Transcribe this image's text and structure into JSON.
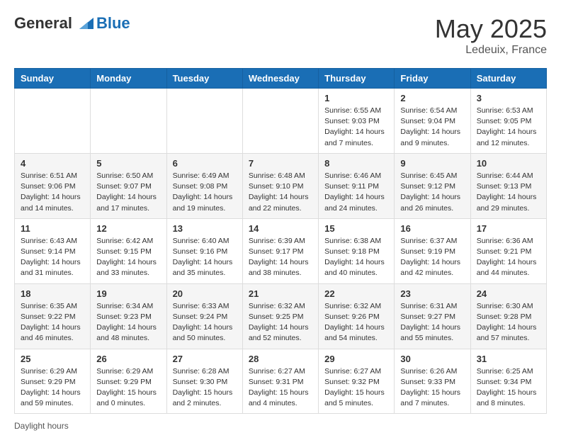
{
  "header": {
    "logo_general": "General",
    "logo_blue": "Blue",
    "month_year": "May 2025",
    "location": "Ledeuix, France"
  },
  "days_of_week": [
    "Sunday",
    "Monday",
    "Tuesday",
    "Wednesday",
    "Thursday",
    "Friday",
    "Saturday"
  ],
  "weeks": [
    [
      {
        "num": "",
        "info": ""
      },
      {
        "num": "",
        "info": ""
      },
      {
        "num": "",
        "info": ""
      },
      {
        "num": "",
        "info": ""
      },
      {
        "num": "1",
        "info": "Sunrise: 6:55 AM\nSunset: 9:03 PM\nDaylight: 14 hours\nand 7 minutes."
      },
      {
        "num": "2",
        "info": "Sunrise: 6:54 AM\nSunset: 9:04 PM\nDaylight: 14 hours\nand 9 minutes."
      },
      {
        "num": "3",
        "info": "Sunrise: 6:53 AM\nSunset: 9:05 PM\nDaylight: 14 hours\nand 12 minutes."
      }
    ],
    [
      {
        "num": "4",
        "info": "Sunrise: 6:51 AM\nSunset: 9:06 PM\nDaylight: 14 hours\nand 14 minutes."
      },
      {
        "num": "5",
        "info": "Sunrise: 6:50 AM\nSunset: 9:07 PM\nDaylight: 14 hours\nand 17 minutes."
      },
      {
        "num": "6",
        "info": "Sunrise: 6:49 AM\nSunset: 9:08 PM\nDaylight: 14 hours\nand 19 minutes."
      },
      {
        "num": "7",
        "info": "Sunrise: 6:48 AM\nSunset: 9:10 PM\nDaylight: 14 hours\nand 22 minutes."
      },
      {
        "num": "8",
        "info": "Sunrise: 6:46 AM\nSunset: 9:11 PM\nDaylight: 14 hours\nand 24 minutes."
      },
      {
        "num": "9",
        "info": "Sunrise: 6:45 AM\nSunset: 9:12 PM\nDaylight: 14 hours\nand 26 minutes."
      },
      {
        "num": "10",
        "info": "Sunrise: 6:44 AM\nSunset: 9:13 PM\nDaylight: 14 hours\nand 29 minutes."
      }
    ],
    [
      {
        "num": "11",
        "info": "Sunrise: 6:43 AM\nSunset: 9:14 PM\nDaylight: 14 hours\nand 31 minutes."
      },
      {
        "num": "12",
        "info": "Sunrise: 6:42 AM\nSunset: 9:15 PM\nDaylight: 14 hours\nand 33 minutes."
      },
      {
        "num": "13",
        "info": "Sunrise: 6:40 AM\nSunset: 9:16 PM\nDaylight: 14 hours\nand 35 minutes."
      },
      {
        "num": "14",
        "info": "Sunrise: 6:39 AM\nSunset: 9:17 PM\nDaylight: 14 hours\nand 38 minutes."
      },
      {
        "num": "15",
        "info": "Sunrise: 6:38 AM\nSunset: 9:18 PM\nDaylight: 14 hours\nand 40 minutes."
      },
      {
        "num": "16",
        "info": "Sunrise: 6:37 AM\nSunset: 9:19 PM\nDaylight: 14 hours\nand 42 minutes."
      },
      {
        "num": "17",
        "info": "Sunrise: 6:36 AM\nSunset: 9:21 PM\nDaylight: 14 hours\nand 44 minutes."
      }
    ],
    [
      {
        "num": "18",
        "info": "Sunrise: 6:35 AM\nSunset: 9:22 PM\nDaylight: 14 hours\nand 46 minutes."
      },
      {
        "num": "19",
        "info": "Sunrise: 6:34 AM\nSunset: 9:23 PM\nDaylight: 14 hours\nand 48 minutes."
      },
      {
        "num": "20",
        "info": "Sunrise: 6:33 AM\nSunset: 9:24 PM\nDaylight: 14 hours\nand 50 minutes."
      },
      {
        "num": "21",
        "info": "Sunrise: 6:32 AM\nSunset: 9:25 PM\nDaylight: 14 hours\nand 52 minutes."
      },
      {
        "num": "22",
        "info": "Sunrise: 6:32 AM\nSunset: 9:26 PM\nDaylight: 14 hours\nand 54 minutes."
      },
      {
        "num": "23",
        "info": "Sunrise: 6:31 AM\nSunset: 9:27 PM\nDaylight: 14 hours\nand 55 minutes."
      },
      {
        "num": "24",
        "info": "Sunrise: 6:30 AM\nSunset: 9:28 PM\nDaylight: 14 hours\nand 57 minutes."
      }
    ],
    [
      {
        "num": "25",
        "info": "Sunrise: 6:29 AM\nSunset: 9:29 PM\nDaylight: 14 hours\nand 59 minutes."
      },
      {
        "num": "26",
        "info": "Sunrise: 6:29 AM\nSunset: 9:29 PM\nDaylight: 15 hours\nand 0 minutes."
      },
      {
        "num": "27",
        "info": "Sunrise: 6:28 AM\nSunset: 9:30 PM\nDaylight: 15 hours\nand 2 minutes."
      },
      {
        "num": "28",
        "info": "Sunrise: 6:27 AM\nSunset: 9:31 PM\nDaylight: 15 hours\nand 4 minutes."
      },
      {
        "num": "29",
        "info": "Sunrise: 6:27 AM\nSunset: 9:32 PM\nDaylight: 15 hours\nand 5 minutes."
      },
      {
        "num": "30",
        "info": "Sunrise: 6:26 AM\nSunset: 9:33 PM\nDaylight: 15 hours\nand 7 minutes."
      },
      {
        "num": "31",
        "info": "Sunrise: 6:25 AM\nSunset: 9:34 PM\nDaylight: 15 hours\nand 8 minutes."
      }
    ]
  ],
  "footer": {
    "daylight_label": "Daylight hours"
  }
}
